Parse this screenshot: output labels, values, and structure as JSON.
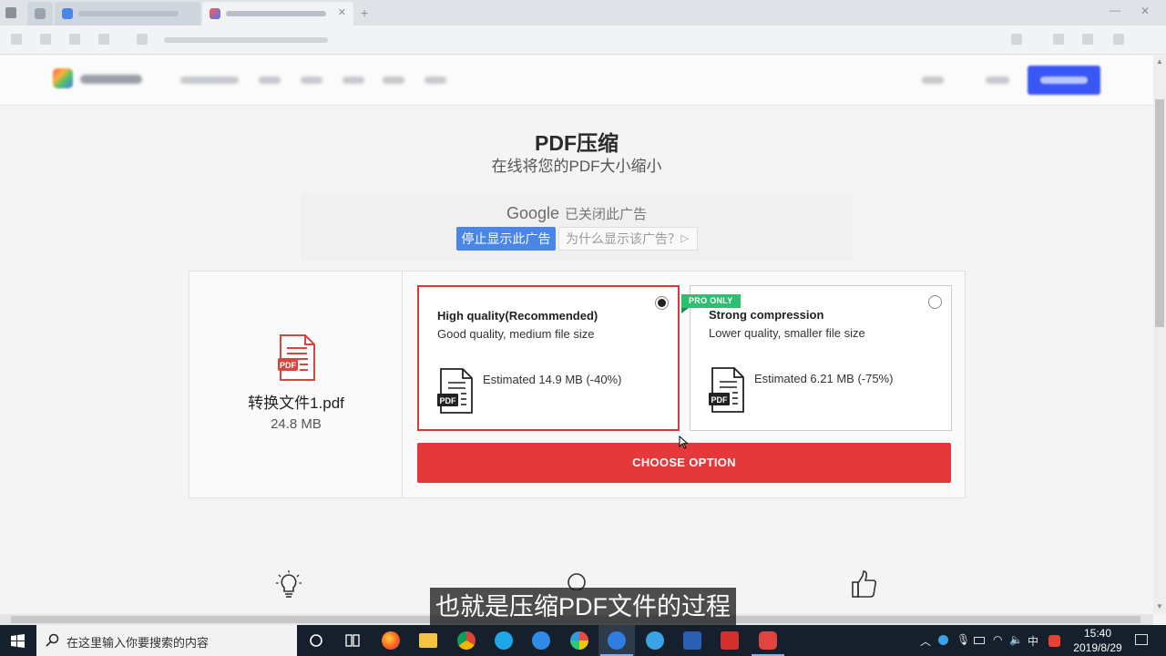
{
  "page": {
    "title": "PDF压缩",
    "subtitle": "在线将您的PDF大小缩小"
  },
  "ad": {
    "google_label": "Google",
    "closed_text": "已关闭此广告",
    "stop_button": "停止显示此广告",
    "why_button": "为什么显示该广告？"
  },
  "file": {
    "icon_label": "PDF",
    "name": "转换文件1.pdf",
    "size": "24.8 MB"
  },
  "options": [
    {
      "title": "High quality(Recommended)",
      "description": "Good quality, medium file size",
      "estimate": "Estimated 14.9 MB (-40%)",
      "selected": true
    },
    {
      "badge": "PRO ONLY",
      "title": "Strong compression",
      "description": "Lower quality, smaller file size",
      "estimate": "Estimated 6.21 MB (-75%)",
      "selected": false
    }
  ],
  "doc_icon_label": "PDF",
  "choose_button": "CHOOSE OPTION",
  "caption": "也就是压缩PDF文件的过程",
  "taskbar": {
    "search_placeholder": "在这里输入你要搜索的内容",
    "ime": "中",
    "time": "15:40",
    "date": "2019/8/29"
  },
  "colors": {
    "accent_red": "#e5383a",
    "selected_border": "#d63a3a",
    "pro_badge": "#2fbf71",
    "ad_blue": "#4a86e8",
    "signup_blue": "#3a57f5"
  }
}
